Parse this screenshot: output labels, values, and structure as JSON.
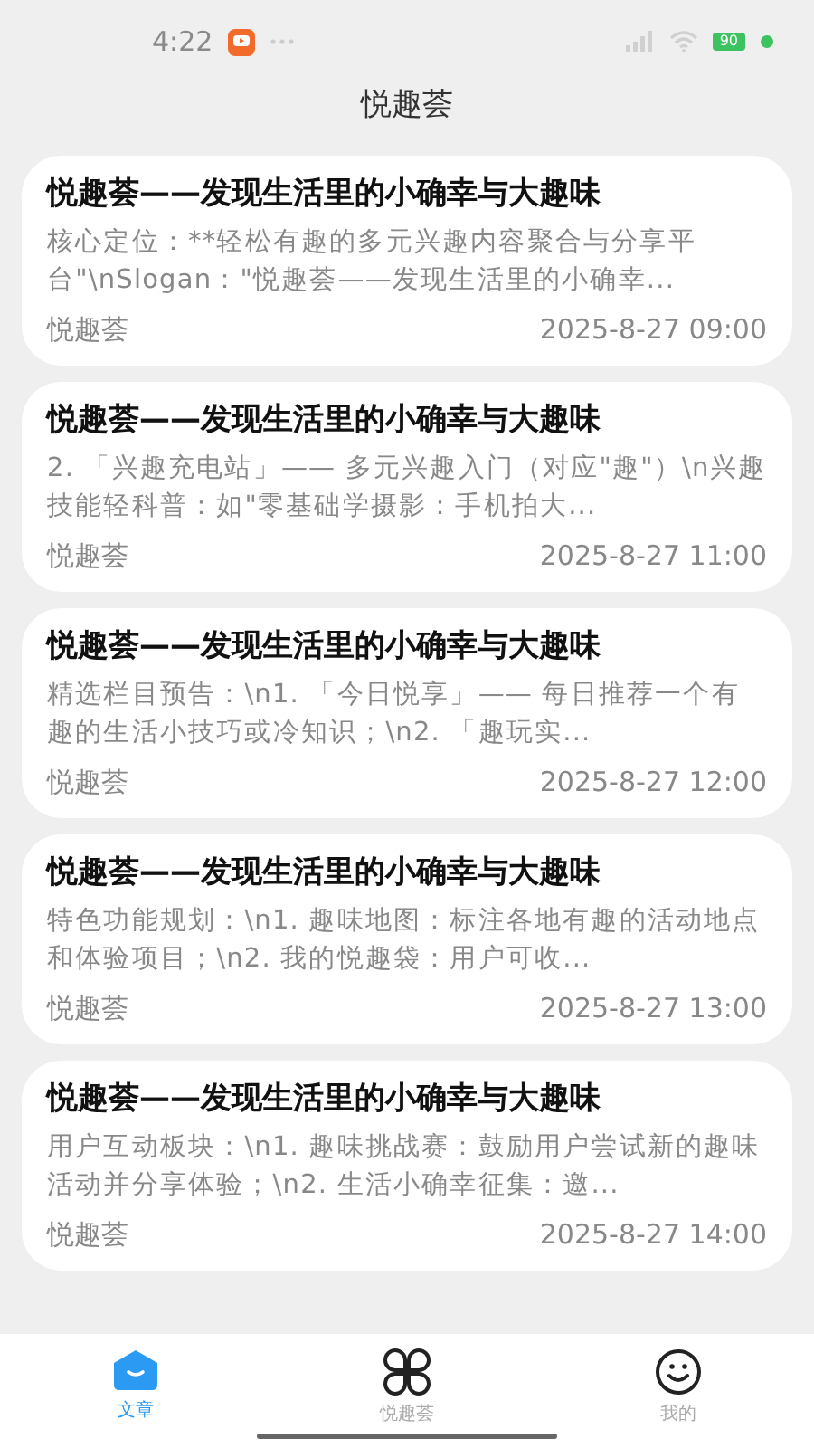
{
  "status_bar": {
    "time": "4:22",
    "battery": "90"
  },
  "header": {
    "title": "悦趣荟"
  },
  "articles": [
    {
      "title": "悦趣荟——发现生活里的小确幸与大趣味",
      "summary": "核心定位：**轻松有趣的多元兴趣内容聚合与分享平台\"\\nSlogan：\"悦趣荟——发现生活里的小确幸...",
      "source": "悦趣荟",
      "time": "2025-8-27 09:00"
    },
    {
      "title": "悦趣荟——发现生活里的小确幸与大趣味",
      "summary": "2. 「兴趣充电站」—— 多元兴趣入门（对应\"趣\"）\\n兴趣技能轻科普：如\"零基础学摄影：手机拍大...",
      "source": "悦趣荟",
      "time": "2025-8-27 11:00"
    },
    {
      "title": "悦趣荟——发现生活里的小确幸与大趣味",
      "summary": "精选栏目预告：\\n1. 「今日悦享」—— 每日推荐一个有趣的生活小技巧或冷知识；\\n2. 「趣玩实...",
      "source": "悦趣荟",
      "time": "2025-8-27 12:00"
    },
    {
      "title": "悦趣荟——发现生活里的小确幸与大趣味",
      "summary": "特色功能规划：\\n1. 趣味地图：标注各地有趣的活动地点和体验项目；\\n2. 我的悦趣袋：用户可收...",
      "source": "悦趣荟",
      "time": "2025-8-27 13:00"
    },
    {
      "title": "悦趣荟——发现生活里的小确幸与大趣味",
      "summary": "用户互动板块：\\n1. 趣味挑战赛：鼓励用户尝试新的趣味活动并分享体验；\\n2. 生活小确幸征集：邀...",
      "source": "悦趣荟",
      "time": "2025-8-27 14:00"
    }
  ],
  "tab_bar": [
    {
      "label": "文章",
      "kind": "home",
      "selected": true
    },
    {
      "label": "悦趣荟",
      "kind": "clover",
      "selected": false
    },
    {
      "label": "我的",
      "kind": "smile",
      "selected": false
    }
  ]
}
